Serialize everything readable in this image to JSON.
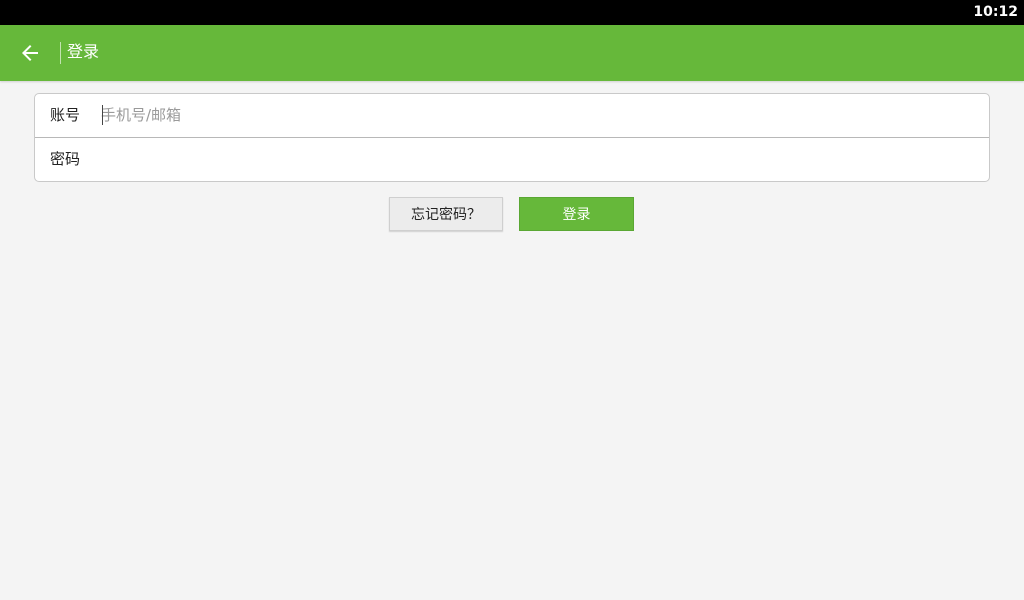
{
  "status_bar": {
    "time": "10:12"
  },
  "app_bar": {
    "back_icon": "arrow-left-icon",
    "title": "登录",
    "background_color": "#66b83a"
  },
  "form": {
    "account": {
      "label": "账号",
      "value": "",
      "placeholder": "手机号/邮箱"
    },
    "password": {
      "label": "密码",
      "value": "",
      "placeholder": ""
    }
  },
  "buttons": {
    "forgot_password_label": "忘记密码？",
    "login_label": "登录",
    "accent_color": "#66b83a"
  }
}
